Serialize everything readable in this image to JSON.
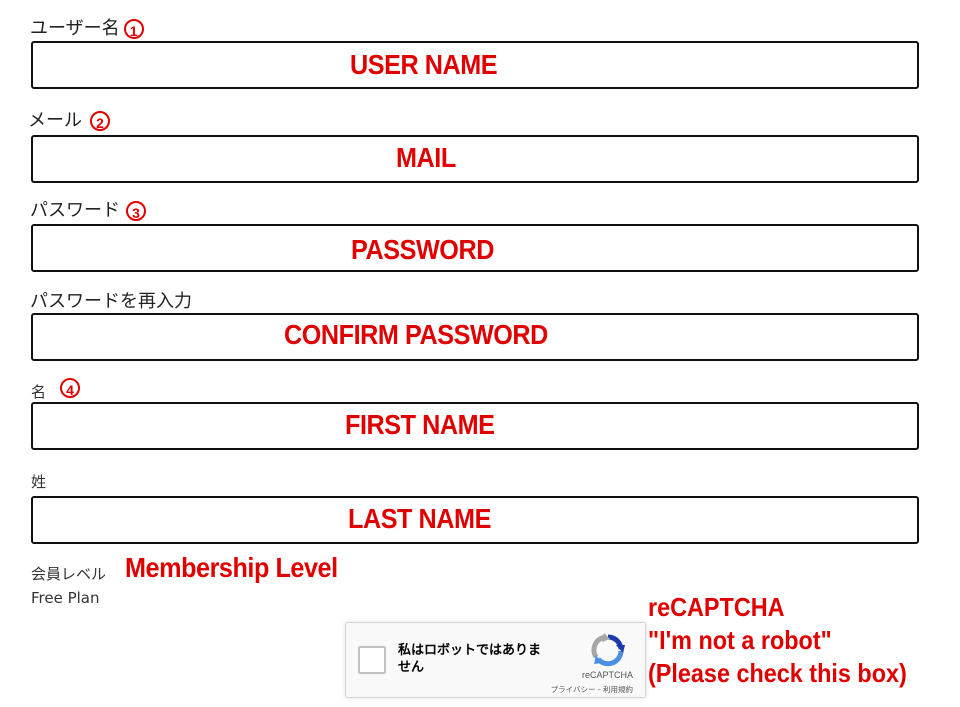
{
  "fields": [
    {
      "label": "ユーザー名",
      "num": "1",
      "annotation": "USER NAME"
    },
    {
      "label": "メール",
      "num": "2",
      "annotation": "MAIL"
    },
    {
      "label": "パスワード",
      "num": "3",
      "annotation": "PASSWORD"
    },
    {
      "label": "パスワードを再入力",
      "annotation": "CONFIRM PASSWORD"
    },
    {
      "label": "名",
      "num": "4",
      "annotation": "FIRST NAME"
    },
    {
      "label": "姓",
      "annotation": "LAST NAME"
    }
  ],
  "membership": {
    "label": "会員レベル",
    "value": "Free Plan",
    "annotation": "Membership Level"
  },
  "recaptcha": {
    "checkbox_text": "私はロボットではありません",
    "brand": "reCAPTCHA",
    "links": "プライバシー - 利用規約",
    "note_line1": "reCAPTCHA",
    "note_line2": "\"I'm not a robot\"",
    "note_line3": "(Please check this box)"
  },
  "colors": {
    "annotation": "#e00000",
    "field_border": "#111111",
    "recaptcha_blue": "#1c3aa9"
  },
  "icons": [
    "recaptcha-logo-icon",
    "circled-number-icon"
  ]
}
